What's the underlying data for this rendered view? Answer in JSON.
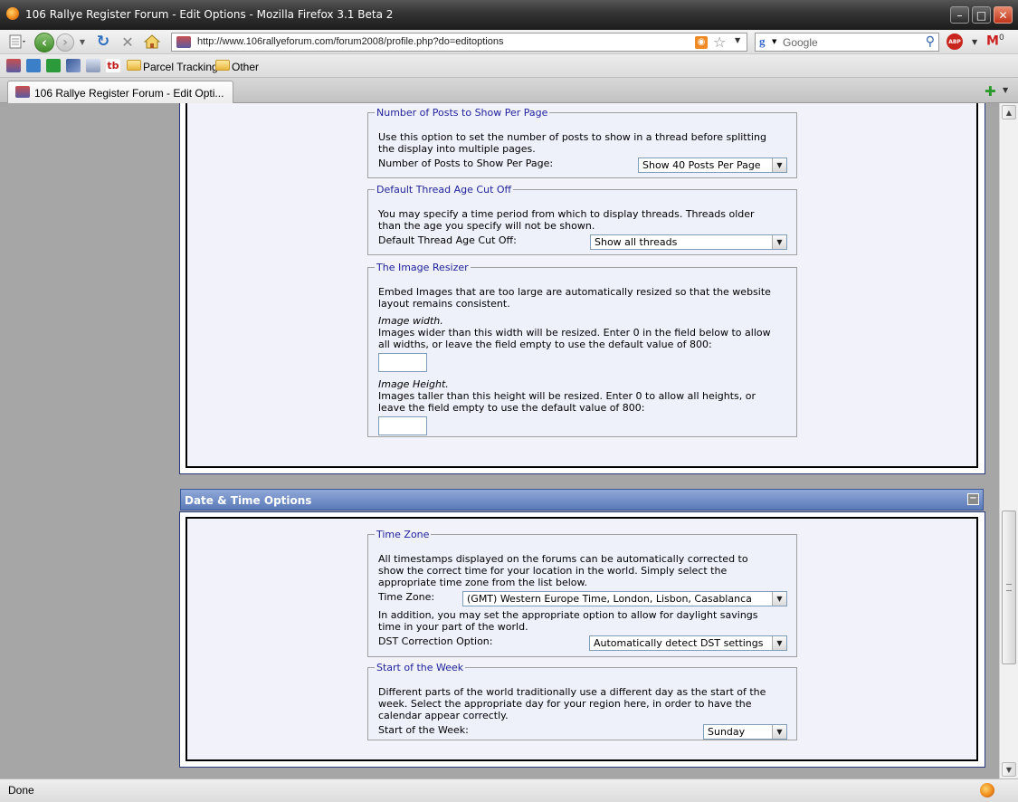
{
  "window": {
    "title": "106 Rallye Register Forum - Edit Options - Mozilla Firefox 3.1 Beta 2",
    "minimize": "–",
    "maximize": "□",
    "close": "✕"
  },
  "navbar": {
    "url": "http://www.106rallyeforum.com/forum2008/profile.php?do=editoptions",
    "search_placeholder": "Google",
    "search_engine_glyph": "g",
    "addon_abp": "ABP",
    "gmail_glyph": "M",
    "gmail_count": "0"
  },
  "bookmarks": {
    "items": [
      {
        "label": "Parcel Tracking",
        "icon": "folder-icon"
      },
      {
        "label": "Other",
        "icon": "folder-icon"
      }
    ]
  },
  "tabs": [
    {
      "title": "106 Rallye Register Forum - Edit Opti..."
    }
  ],
  "sections": {
    "posts_per_page": {
      "legend": "Number of Posts to Show Per Page",
      "desc1": "Use this option to set the number of posts to show in a thread before splitting",
      "desc2": "the display into multiple pages.",
      "label": "Number of Posts to Show Per Page:",
      "selected": "Show 40 Posts Per Page"
    },
    "thread_age": {
      "legend": "Default Thread Age Cut Off",
      "desc1": "You may specify a time period from which to display threads. Threads older",
      "desc2": "than the age you specify will not be shown.",
      "label": "Default Thread Age Cut Off:",
      "selected": "Show all threads"
    },
    "image_resizer": {
      "legend": "The Image Resizer",
      "desc1": "Embed Images that are too large are automatically resized so that the website",
      "desc2": "layout remains consistent.",
      "width_title": "Image width.",
      "width_desc1": "Images wider than this width will be resized. Enter 0 in the field below to allow",
      "width_desc2": "all widths, or leave the field empty to use the default value of 800:",
      "width_value": "",
      "height_title": "Image Height.",
      "height_desc1": "Images taller than this height will be resized. Enter 0 to allow all heights, or",
      "height_desc2": "leave the field empty to use the default value of 800:",
      "height_value": ""
    },
    "date_time": {
      "header": "Date & Time Options",
      "collapse_glyph": "−"
    },
    "time_zone": {
      "legend": "Time Zone",
      "desc1": "All timestamps displayed on the forums can be automatically corrected to",
      "desc2": "show the correct time for your location in the world. Simply select the",
      "desc3": "appropriate time zone from the list below.",
      "label": "Time Zone:",
      "selected": "(GMT) Western Europe Time, London, Lisbon, Casablanca",
      "dst_desc1": "In addition, you may set the appropriate option to allow for daylight savings",
      "dst_desc2": "time in your part of the world.",
      "dst_label": "DST Correction Option:",
      "dst_selected": "Automatically detect DST settings"
    },
    "start_week": {
      "legend": "Start of the Week",
      "desc1": "Different parts of the world traditionally use a different day as the start of the",
      "desc2": "week. Select the appropriate day for your region here, in order to have the",
      "desc3": "calendar appear correctly.",
      "label": "Start of the Week:",
      "selected": "Sunday"
    }
  },
  "status": {
    "text": "Done"
  },
  "glyphs": {
    "dropdown": "▼",
    "scroll_up": "▲",
    "scroll_down": "▼"
  }
}
